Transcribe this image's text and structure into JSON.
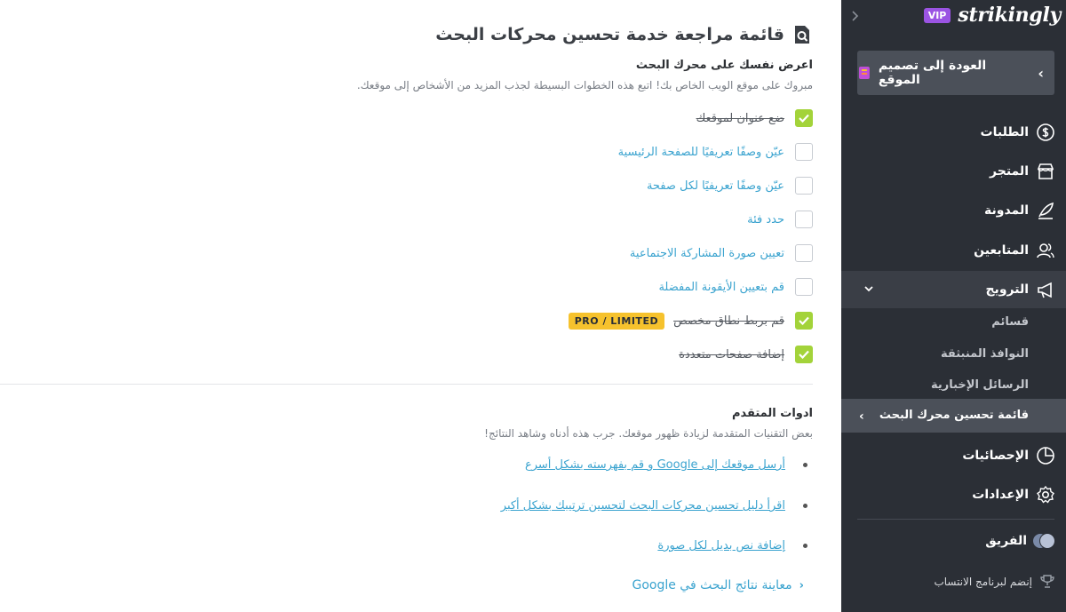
{
  "sidebar": {
    "brand": {
      "vip": "VIP",
      "logo": "strikingly"
    },
    "back_label": "العودة إلى تصميم الموقع",
    "nav": {
      "orders": "الطلبات",
      "store": "المتجر",
      "blog": "المدونة",
      "followers": "المتابعين",
      "promotion": "الترويج",
      "stats": "الإحصائيات",
      "settings": "الإعدادات",
      "team": "الفريق",
      "affiliate": "إنضم لبرنامج الانتساب"
    },
    "promo_sub": {
      "lists": "قسائم",
      "popups": "النوافذ المنبثقة",
      "newsletters": "الرسائل الإخبارية",
      "seo_checklist": "قائمة تحسين محرك البحث"
    }
  },
  "main": {
    "title": "قائمة مراجعة خدمة تحسين محركات البحث",
    "section1": {
      "heading": "اعرض نفسك على محرك البحث",
      "desc": "مبروك على موقع الويب الخاص بك! اتبع هذه الخطوات البسيطة لجذب المزيد من الأشخاص إلى موقعك."
    },
    "checklist": [
      {
        "label": "ضع عنوان لموقعك",
        "done": true
      },
      {
        "label": "عيّن وصفًا تعريفيًا للصفحة الرئيسية",
        "done": false
      },
      {
        "label": "عيّن وصفًا تعريفيًا لكل صفحة",
        "done": false
      },
      {
        "label": "حدد فئة",
        "done": false
      },
      {
        "label": "تعيين صورة المشاركة الاجتماعية",
        "done": false
      },
      {
        "label": "قم بتعيين الأيقونة المفضلة",
        "done": false
      },
      {
        "label": "قم بربط نطاق مخصص",
        "done": true,
        "badge": "PRO / LIMITED"
      },
      {
        "label": "إضافة صفحات متعددة",
        "done": true
      }
    ],
    "section2": {
      "heading": "ادوات المتقدم",
      "desc": "بعض التقنيات المتقدمة لزيادة ظهور موقعك. جرب هذه أدناه وشاهد النتائج!"
    },
    "tools": [
      "أرسل موقعك إلى Google و قم بفهرسته بشكل أسرع",
      "اقرأ دليل تحسين محركات البحث لتحسين ترتيبك بشكل أكبر",
      "إضافة نص بديل لكل صورة"
    ],
    "preview_label": "معاينة نتائج البحث في Google"
  },
  "colors": {
    "sidebar_bg": "#2b2f36",
    "accent_green": "#a3d33a",
    "link_blue": "#3aa3cf",
    "vip_purple": "#9b54e3",
    "badge_yellow": "#f6c22d"
  }
}
